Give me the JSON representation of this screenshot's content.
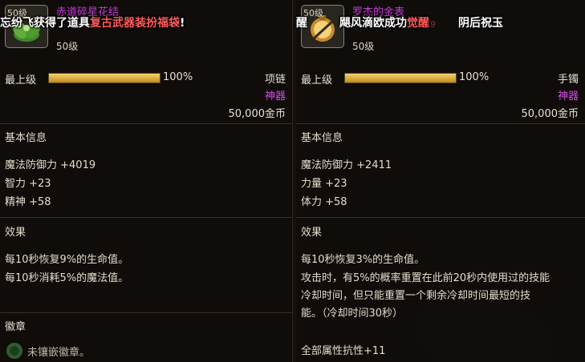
{
  "left": {
    "icon_level": "50级",
    "name": "赤道碎星花结",
    "subtitle": "",
    "level": "50级",
    "grade_label": "最上级",
    "grade_pct": "100%",
    "grade_fill": 1.0,
    "type": "项链",
    "rarity": "神器",
    "price": "50,000金币",
    "basic_title": "基本信息",
    "stats": [
      "魔法防御力 +4019",
      "智力 +23",
      "精神 +58"
    ],
    "effect_title": "效果",
    "effects": [
      "每10秒恢复9%的生命值。",
      "每10秒消耗5%的魔法值。"
    ],
    "emblem_title": "徽章",
    "emblem_text": "未镶嵌徽章。",
    "notice_pre": "忘纷飞获得了道具",
    "notice_item": "复古武器装扮福袋",
    "notice_post": "!"
  },
  "right": {
    "icon_level": "50级",
    "name": "罗杰的金表",
    "subtitle": "59",
    "level": "50级",
    "grade_label": "最上级",
    "grade_pct": "100%",
    "grade_fill": 1.0,
    "type": "手镯",
    "rarity": "神器",
    "price": "50,000金币",
    "basic_title": "基本信息",
    "stats": [
      "魔法防御力 +2411",
      "力量 +23",
      "体力 +58"
    ],
    "effect_title": "效果",
    "effects": [
      "每10秒恢复3%的生命值。",
      "攻击时，有5%的概率重置在此前20秒内使用过的技能",
      "冷却时间，但只能重置一个剩余冷却时间最短的技",
      "能。（冷却时间30秒）",
      "",
      "全部属性抗性+11"
    ],
    "notice_pre": "醒",
    "notice_mid": "飓风滴欧成功",
    "notice_item": "觉醒",
    "notice_post": "阴后祝玉"
  },
  "colors": {
    "rarity": "#d64be8",
    "name": "#c23bd5",
    "notice_highlight": "#ff5a5a",
    "bar": "#e0b23a"
  }
}
